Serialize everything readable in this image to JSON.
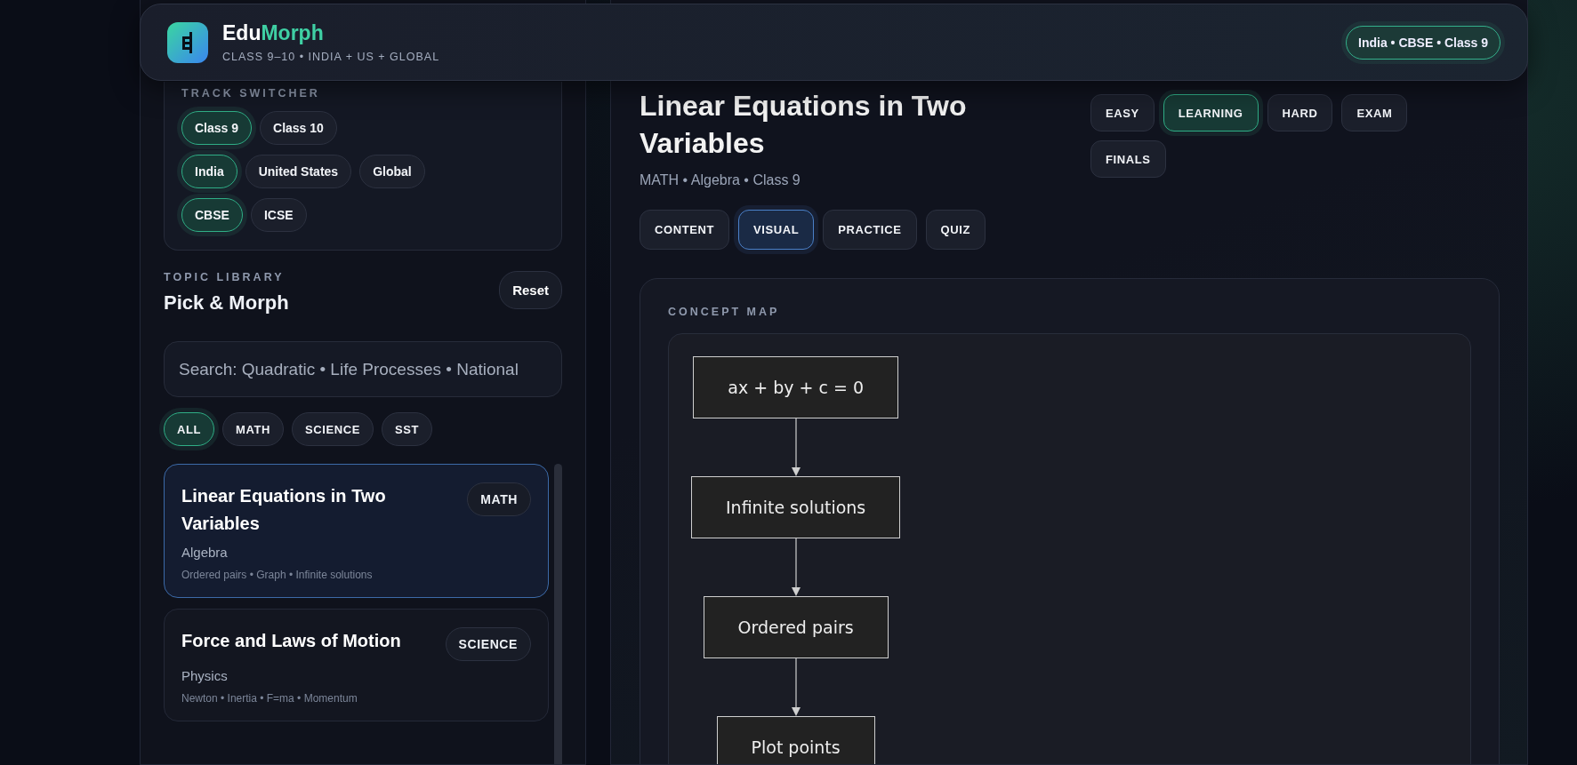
{
  "header": {
    "brand": [
      {
        "text": "Edu",
        "color": "#ffffff"
      },
      {
        "text": "Morph",
        "color": "#3fd0a4"
      }
    ],
    "subtitle": "CLASS 9–10 • INDIA + US + GLOBAL",
    "context_pill": "India • CBSE • Class 9"
  },
  "track_switcher": {
    "title": "TRACK SWITCHER",
    "groups": [
      [
        {
          "label": "Class 9",
          "selected": true
        },
        {
          "label": "Class 10",
          "selected": false
        }
      ],
      [
        {
          "label": "India",
          "selected": true
        },
        {
          "label": "United States",
          "selected": false
        },
        {
          "label": "Global",
          "selected": false
        }
      ],
      [
        {
          "label": "CBSE",
          "selected": true
        },
        {
          "label": "ICSE",
          "selected": false
        }
      ]
    ]
  },
  "topic_library": {
    "eyebrow": "TOPIC LIBRARY",
    "title": "Pick & Morph",
    "reset": "Reset",
    "search": {
      "placeholder": "Search: Quadratic • Life Processes • National"
    },
    "filters": [
      {
        "label": "ALL",
        "selected": true
      },
      {
        "label": "MATH",
        "selected": false
      },
      {
        "label": "SCIENCE",
        "selected": false
      },
      {
        "label": "SST",
        "selected": false
      }
    ],
    "topics": [
      {
        "title": "Linear Equations in Two Variables",
        "subject": "MATH",
        "chapter": "Algebra",
        "keywords": "Ordered pairs • Graph • Infinite solutions",
        "selected": true
      },
      {
        "title": "Force and Laws of Motion",
        "subject": "SCIENCE",
        "chapter": "Physics",
        "keywords": "Newton • Inertia • F=ma • Momentum",
        "selected": false
      }
    ]
  },
  "main": {
    "title": "Linear Equations in Two Variables",
    "meta": "MATH • Algebra • Class 9",
    "levels": [
      {
        "label": "EASY",
        "selected": false
      },
      {
        "label": "LEARNING",
        "selected": true
      },
      {
        "label": "HARD",
        "selected": false
      },
      {
        "label": "EXAM",
        "selected": false
      },
      {
        "label": "FINALS",
        "selected": false
      }
    ],
    "tabs": [
      {
        "label": "CONTENT",
        "selected": false
      },
      {
        "label": "VISUAL",
        "selected": true
      },
      {
        "label": "PRACTICE",
        "selected": false
      },
      {
        "label": "QUIZ",
        "selected": false
      }
    ],
    "concept_map": {
      "label": "CONCEPT MAP",
      "nodes": [
        "ax + by + c = 0",
        "Infinite solutions",
        "Ordered pairs",
        "Plot points"
      ]
    }
  }
}
